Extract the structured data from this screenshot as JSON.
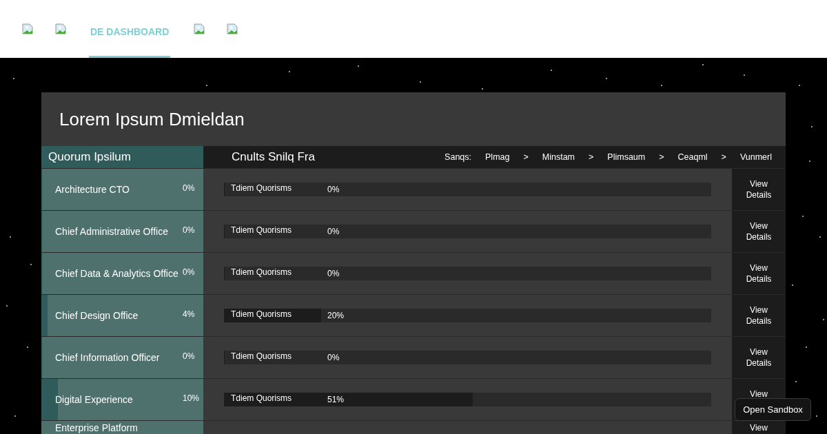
{
  "nav": [
    {
      "kind": "image",
      "selected": false
    },
    {
      "kind": "image",
      "selected": false
    },
    {
      "kind": "text",
      "label": "DE DASHBOARD",
      "selected": true
    },
    {
      "kind": "image",
      "selected": false
    },
    {
      "kind": "image",
      "selected": false
    }
  ],
  "panel": {
    "title": "Lorem Ipsum Dmieldan",
    "left_heading": "Quorum Ipsilum",
    "right_heading": "Cnults Snilq Fra",
    "breadcrumb": {
      "label": "Sanqs:",
      "items": [
        "Plmag",
        ">",
        "Minstam",
        ">",
        "Plimsaum",
        ">",
        "Ceaqml",
        ">",
        "Vunmerl"
      ]
    },
    "rows": [
      {
        "name": "Architecture CTO",
        "percent": "0%",
        "level": 0,
        "progress": {
          "label": "Tdiem Quorisms",
          "reading": "0%",
          "level": 0
        },
        "action": "View Details"
      },
      {
        "name": "Chief Administrative Office",
        "percent": "0%",
        "level": 0,
        "progress": {
          "label": "Tdiem Quorisms",
          "reading": "0%",
          "level": 0
        },
        "action": "View Details"
      },
      {
        "name": "Chief Data & Analytics Office",
        "percent": "0%",
        "level": 0,
        "progress": {
          "label": "Tdiem Quorisms",
          "reading": "0%",
          "level": 0
        },
        "action": "View Details"
      },
      {
        "name": "Chief Design Office",
        "percent": "4%",
        "level": 0.04,
        "progress": {
          "label": "Tdiem Quorisms",
          "reading": "20%",
          "level": 0.2
        },
        "action": "View Details"
      },
      {
        "name": "Chief Information Officer",
        "percent": "0%",
        "level": 0,
        "progress": {
          "label": "Tdiem Quorisms",
          "reading": "0%",
          "level": 0
        },
        "action": "View Details"
      },
      {
        "name": "Digital Experience",
        "percent": "10%",
        "level": 0.1,
        "progress": {
          "label": "Tdiem Quorisms",
          "reading": "51%",
          "level": 0.51
        },
        "action": "View"
      },
      {
        "name": "Enterprise Platform",
        "action": "View"
      }
    ]
  },
  "sandbox_button": "Open Sandbox"
}
